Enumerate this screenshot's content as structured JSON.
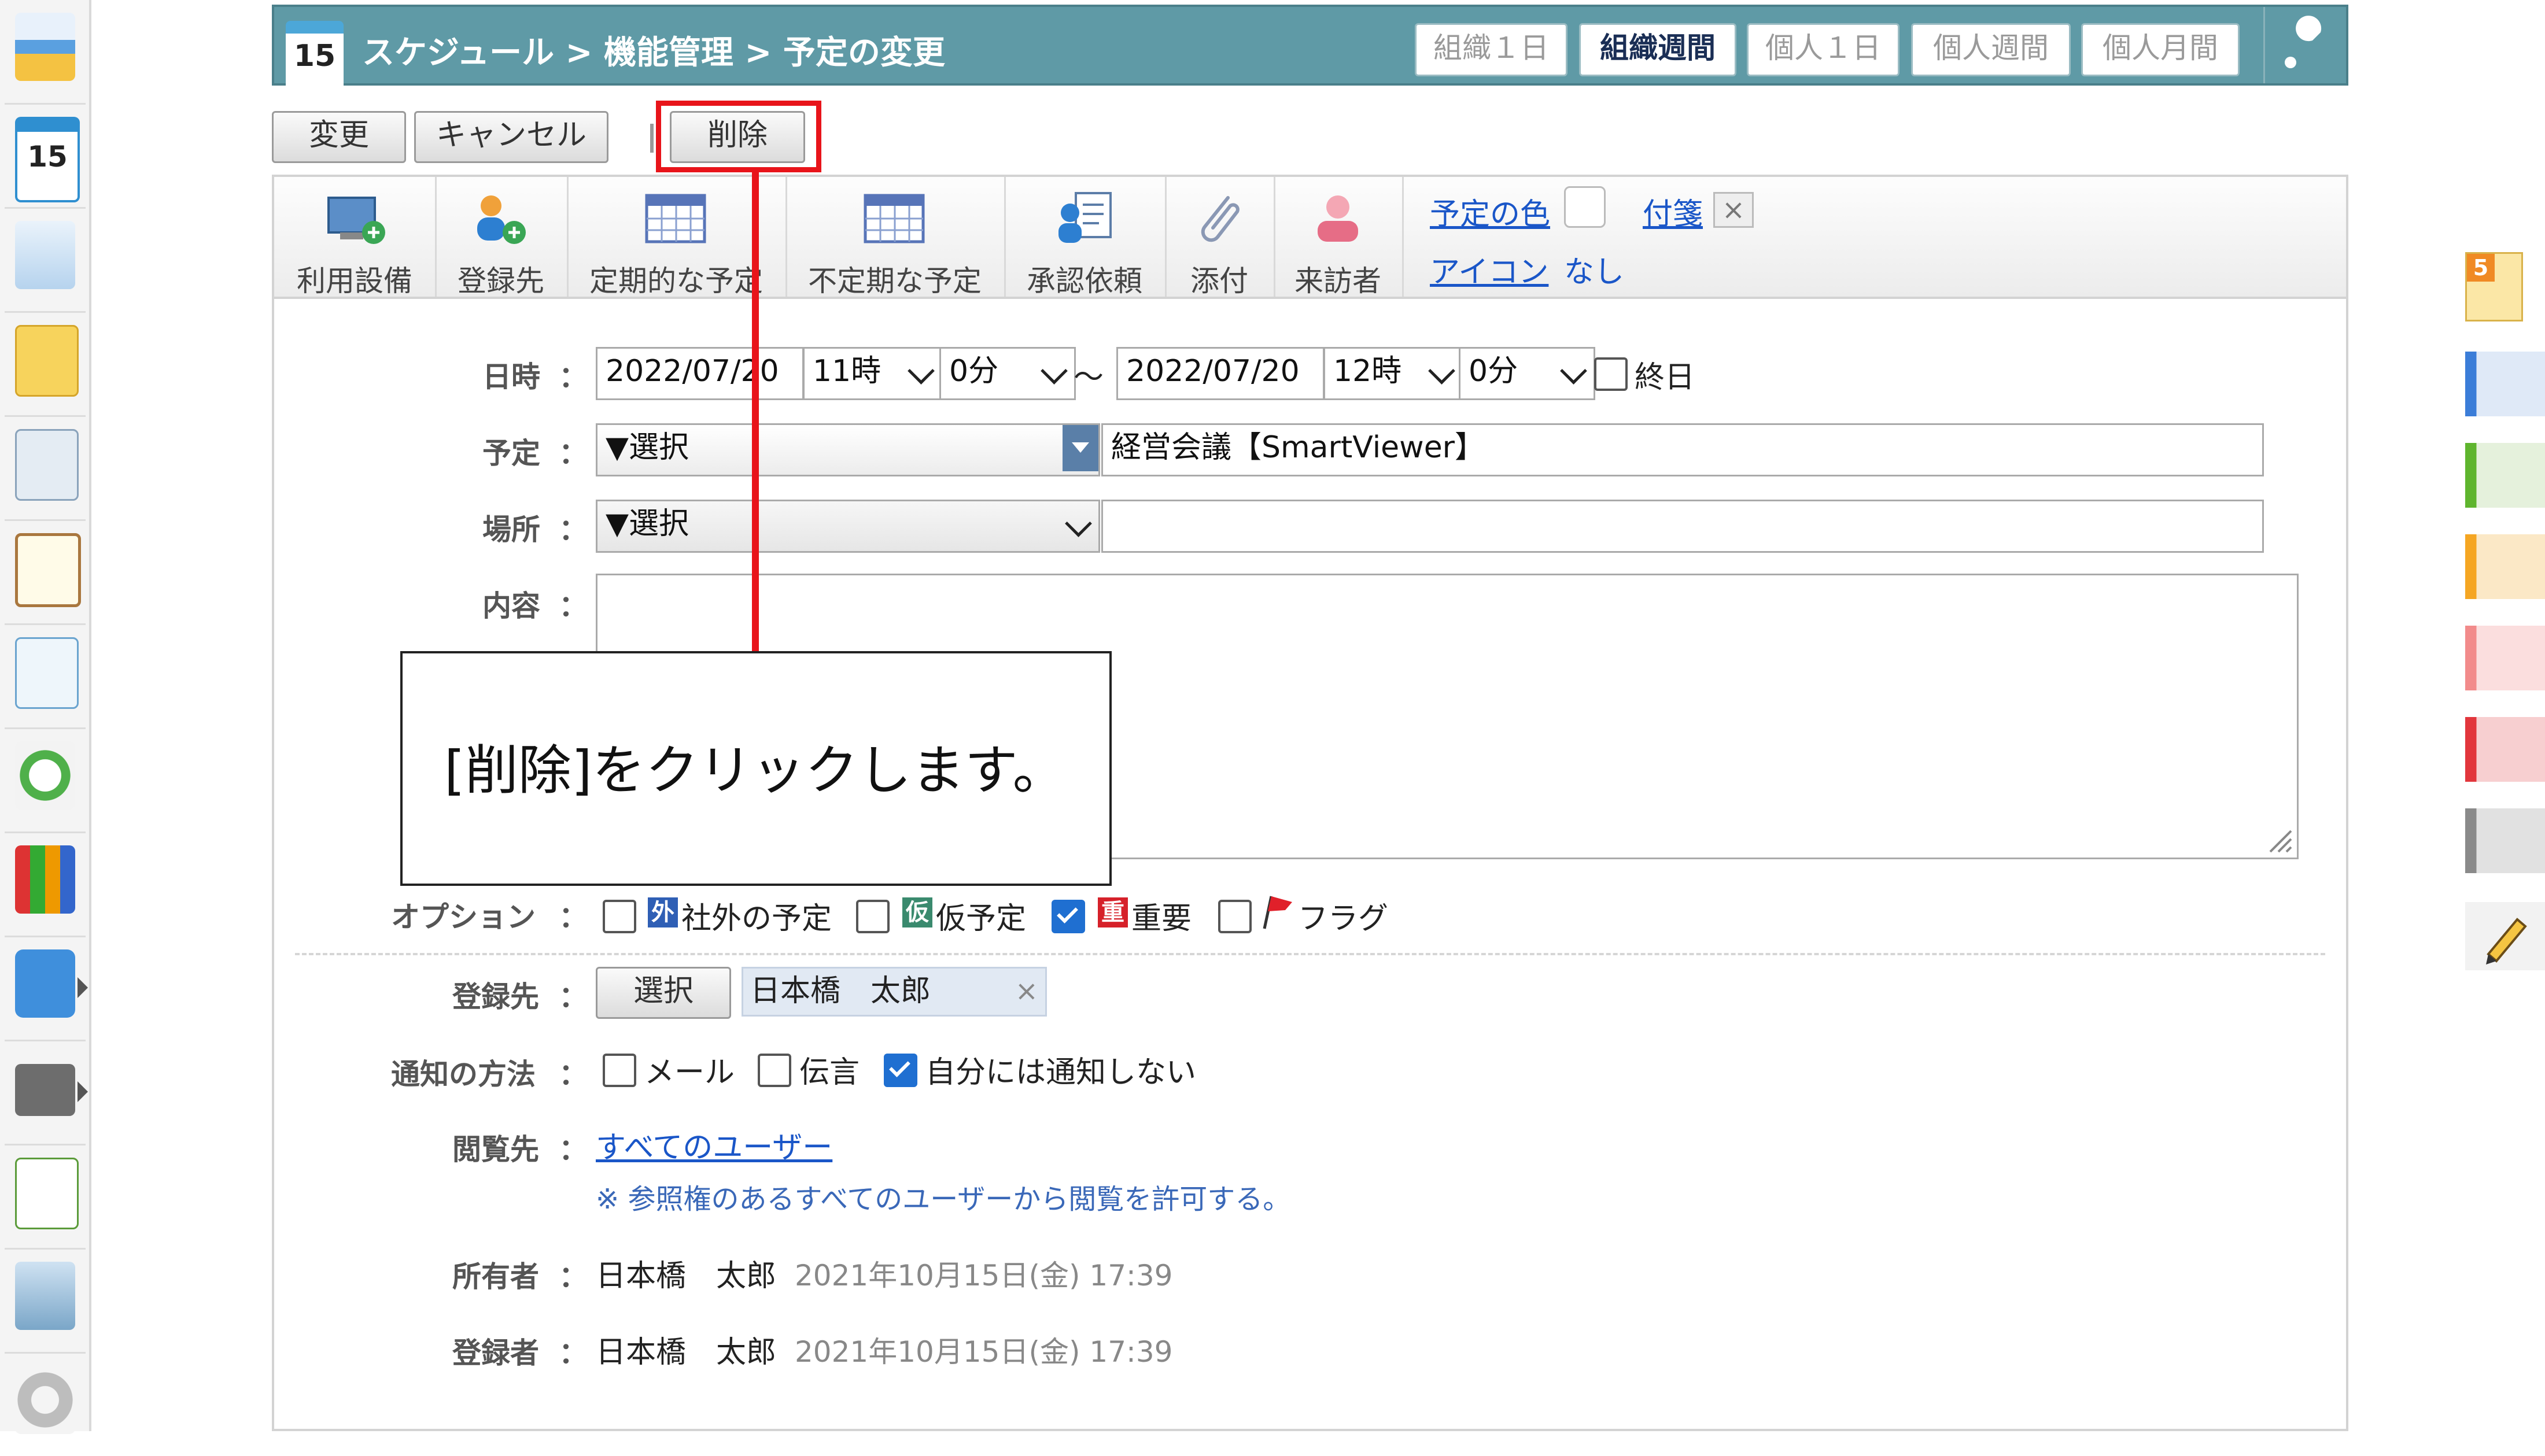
{
  "header": {
    "calendar_day": "15",
    "breadcrumb": "スケジュール > 機能管理 > 予定の変更",
    "views": [
      "組織１日",
      "組織週間",
      "個人１日",
      "個人週間",
      "個人月間"
    ],
    "active_view": "組織週間"
  },
  "actions": {
    "change": "変更",
    "cancel": "キャンセル",
    "delete": "削除"
  },
  "toolbar": {
    "items": [
      "利用設備",
      "登録先",
      "定期的な予定",
      "不定期な予定",
      "承認依頼",
      "添付",
      "来訪者"
    ],
    "color_link": "予定の色",
    "sticky_link": "付箋",
    "icon_link": "アイコン",
    "icon_value": "なし"
  },
  "form": {
    "datetime_label": "日時",
    "start_date": "2022/07/20",
    "start_hour": "11時",
    "start_min": "0分",
    "tilde": "～",
    "end_date": "2022/07/20",
    "end_hour": "12時",
    "end_min": "0分",
    "allday_label": "終日",
    "schedule_label": "予定",
    "select_placeholder": "▼選択",
    "schedule_title": "経営会議【SmartViewer】",
    "place_label": "場所",
    "place_value": "",
    "content_label": "内容",
    "options_label": "オプション",
    "opt_external_badge": "外",
    "opt_external": "社外の予定",
    "opt_tentative_badge": "仮",
    "opt_tentative": "仮予定",
    "opt_important_badge": "重",
    "opt_important": "重要",
    "opt_flag": "フラグ",
    "registrant_label": "登録先",
    "select_btn": "選択",
    "registrant_value": "日本橋　太郎",
    "notify_label": "通知の方法",
    "notify_mail": "メール",
    "notify_message": "伝言",
    "notify_self": "自分には通知しない",
    "viewers_label": "閲覧先",
    "viewers_link": "すべてのユーザー",
    "viewers_note": "※ 参照権のあるすべてのユーザーから閲覧を許可する。",
    "owner_label": "所有者",
    "owner_name": "日本橋　太郎",
    "owner_date": "2021年10月15日(金) 17:39",
    "creator_label": "登録者",
    "creator_name": "日本橋　太郎",
    "creator_date": "2021年10月15日(金) 17:39"
  },
  "colon": "：",
  "callout_text": "[削除]をクリックします。",
  "sticky_badge": "5",
  "colors": {
    "header_bg": "#5f9aa6",
    "accent_red": "#e8141a",
    "link_blue": "#1a56c8",
    "check_blue": "#1f6fd1",
    "tag_colors": [
      "#3b7dd8",
      "#5fb52e",
      "#f5a623",
      "#f28b8b",
      "#e2363c",
      "#8a8a8a"
    ]
  }
}
